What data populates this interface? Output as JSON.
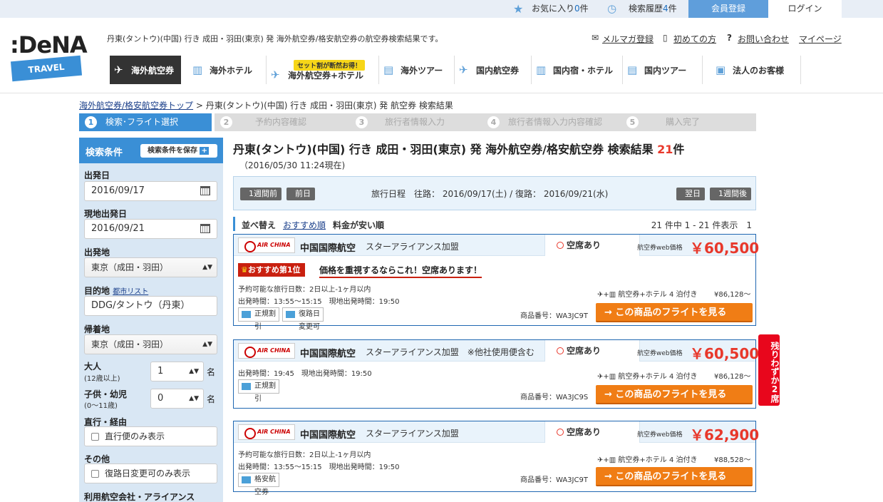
{
  "topbar": {
    "favorites_label": "お気に入り",
    "favorites_count": "0",
    "favorites_unit": "件",
    "history_label": "検索履歴",
    "history_count": "4",
    "history_unit": "件",
    "register": "会員登録",
    "login": "ログイン"
  },
  "logo": {
    "main": ":DeNA",
    "sub": "TRAVEL"
  },
  "header": {
    "description": "丹東(タントウ)(中国) 行き 成田・羽田(東京) 発 海外航空券/格安航空券の航空券検索結果です。",
    "links": [
      "メルマガ登録",
      "初めての方",
      "お問い合わせ",
      "マイページ"
    ]
  },
  "nav": {
    "items": [
      "海外航空券",
      "海外ホテル",
      "海外航空券+ホテル",
      "海外ツアー",
      "国内航空券",
      "国内宿・ホテル",
      "国内ツアー",
      "法人のお客様"
    ],
    "promo": "セット割が断然お得！"
  },
  "breadcrumb": {
    "link": "海外航空券/格安航空券トップ",
    "current": " > 丹東(タントウ)(中国) 行き 成田・羽田(東京) 発 航空券 検索結果"
  },
  "steps": [
    {
      "num": "1",
      "label": "検索･フライト選択"
    },
    {
      "num": "2",
      "label": "予約内容確認"
    },
    {
      "num": "3",
      "label": "旅行者情報入力"
    },
    {
      "num": "4",
      "label": "旅行者情報入力内容確認"
    },
    {
      "num": "5",
      "label": "購入完了"
    }
  ],
  "sidebar": {
    "title": "検索条件",
    "save": "検索条件を保存",
    "departure_date_label": "出発日",
    "departure_date": "2016/09/17",
    "local_date_label": "現地出発日",
    "local_date": "2016/09/21",
    "origin_label": "出発地",
    "origin": "東京（成田・羽田）",
    "destination_label": "目的地",
    "city_list": "都市リスト",
    "destination": "DDG/タントウ（丹東）",
    "return_label": "帰着地",
    "return": "東京（成田・羽田）",
    "adult_label": "大人",
    "adult_sub": "(12歳以上)",
    "adult_value": "1",
    "child_label": "子供・幼児",
    "child_sub": "(0〜11歳)",
    "child_value": "0",
    "unit": "名",
    "direct_label": "直行・経由",
    "direct_option": "直行便のみ表示",
    "other_label": "その他",
    "other_option": "復路日変更可のみ表示",
    "airline_label": "利用航空会社・アライアンス"
  },
  "main": {
    "title": "丹東(タントウ)(中国) 行き 成田・羽田(東京) 発 海外航空券/格安航空券 検索結果 ",
    "count": "21",
    "count_unit": "件",
    "timestamp": "（2016/05/30 11:24現在)",
    "prev_week": "1週間前",
    "prev_day": "前日",
    "next_day": "翌日",
    "next_week": "1週間後",
    "itinerary": "旅行日程　往路： 2016/09/17(土) / 復路： 2016/09/21(水)",
    "sort_label": "並べ替え",
    "sort_recommend": "おすすめ順",
    "sort_price": "料金が安い順",
    "paging": "21 件中 1 - 21 件表示　1"
  },
  "results": [
    {
      "airline": "中国国際航空",
      "alliance": "スターアライアンス加盟",
      "logo": "AIR CHINA",
      "seat": "空席あり",
      "price_label": "航空券web価格",
      "price": "￥60,500",
      "rank": "おすすめ第1位",
      "rank_text": "価格を重視するならこれ！空席あります！",
      "info1": "予約可能な旅行日数：2日以上-1ヶ月以内",
      "info2": "出発時間：13:55〜15:15　現地出発時間：19:50",
      "package": "航空券+ホテル 4 泊付き",
      "package_price": "¥86,128〜",
      "product_no": "商品番号：WA3JC9T",
      "cta": "→ この商品のフライトを見る",
      "tags": [
        "正規割引",
        "復路日変更可"
      ]
    },
    {
      "airline": "中国国際航空",
      "alliance": "スターアライアンス加盟　※他社使用便含む",
      "logo": "AIR CHINA",
      "seat": "空席あり",
      "price_label": "航空券web価格",
      "price": "￥60,500",
      "info1": "出発時間：19:45　現地出発時間：19:50",
      "package": "航空券+ホテル 4 泊付き",
      "package_price": "¥86,128〜",
      "product_no": "商品番号：WA3JC9S",
      "cta": "→ この商品のフライトを見る",
      "tags": [
        "正規割引"
      ]
    },
    {
      "airline": "中国国際航空",
      "alliance": "スターアライアンス加盟",
      "logo": "AIR CHINA",
      "seat": "空席あり",
      "price_label": "航空券web価格",
      "price": "￥62,900",
      "info1": "予約可能な旅行日数：2日以上-1ヶ月以内",
      "info2": "出発時間：13:55〜15:15　現地出発時間：19:50",
      "package": "航空券+ホテル 4 泊付き",
      "package_price": "¥88,528〜",
      "product_no": "商品番号：WA3JC9T",
      "cta": "→ この商品のフライトを見る",
      "tags": [
        "格安航空券"
      ]
    }
  ],
  "side_tag": "残りわずか2席",
  "icons": {
    "star": "star-icon",
    "clock": "clock-icon",
    "mail": "mail-icon",
    "book": "book-icon",
    "help": "help-icon",
    "plane": "plane-icon",
    "hotel": "hotel-icon",
    "calendar": "calendar-icon",
    "crown": "crown-icon"
  },
  "colors": {
    "primary": "#3a8fd6",
    "accent": "#f07d15",
    "price": "#e8382b",
    "dark": "#333333"
  }
}
